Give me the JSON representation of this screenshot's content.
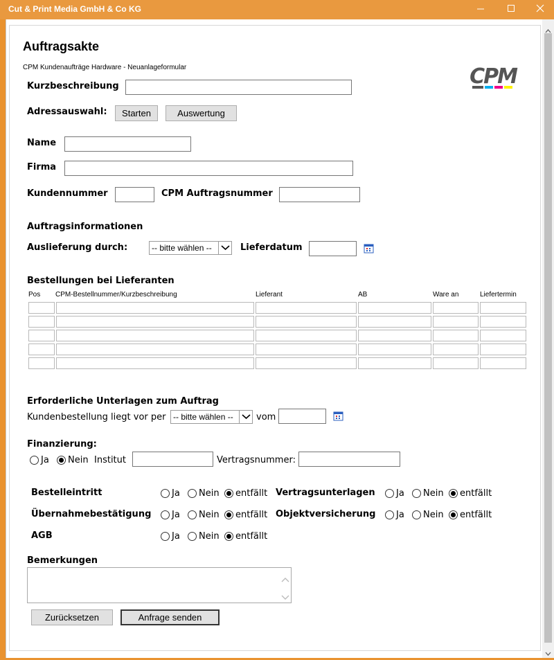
{
  "window": {
    "title": "Cut & Print Media GmbH & Co KG"
  },
  "logo": {
    "text": "CPM"
  },
  "page": {
    "heading": "Auftragsakte",
    "subheading": "CPM Kundenaufträge Hardware - Neuanlageformular"
  },
  "kurzbeschreibung": {
    "label": "Kurzbeschreibung",
    "value": ""
  },
  "adresse": {
    "label": "Adressauswahl:",
    "start_label": "Starten",
    "eval_label": "Auswertung"
  },
  "name": {
    "label": "Name",
    "value": ""
  },
  "firma": {
    "label": "Firma",
    "value": ""
  },
  "kundennummer": {
    "label": "Kundennummer",
    "value": ""
  },
  "auftragsnummer": {
    "label": "CPM Auftragsnummer",
    "value": ""
  },
  "auftragsinfo": {
    "heading": "Auftragsinformationen",
    "auslieferung_label": "Auslieferung durch:",
    "auslieferung_value": "-- bitte wählen --",
    "lieferdatum_label": "Lieferdatum",
    "lieferdatum_value": ""
  },
  "bestellungen": {
    "heading": "Bestellungen bei Lieferanten",
    "columns": [
      "Pos",
      "CPM-Bestellnummer/Kurzbeschreibung",
      "Lieferant",
      "AB",
      "Ware an",
      "Liefertermin"
    ],
    "rows": [
      [
        "",
        "",
        "",
        "",
        "",
        ""
      ],
      [
        "",
        "",
        "",
        "",
        "",
        ""
      ],
      [
        "",
        "",
        "",
        "",
        "",
        ""
      ],
      [
        "",
        "",
        "",
        "",
        "",
        ""
      ],
      [
        "",
        "",
        "",
        "",
        "",
        ""
      ]
    ]
  },
  "unterlagen": {
    "heading": "Erforderliche Unterlagen zum Auftrag",
    "kundenbestellung_label": "Kundenbestellung liegt vor per",
    "kundenbestellung_value": "-- bitte wählen --",
    "vom_label": "vom",
    "vom_value": ""
  },
  "finanzierung": {
    "heading": "Finanzierung:",
    "ja_label": "Ja",
    "nein_label": "Nein",
    "selected": "Nein",
    "institut_label": "Institut",
    "institut_value": "",
    "vertragsnummer_label": "Vertragsnummer:",
    "vertragsnummer_value": ""
  },
  "checks": {
    "options": [
      "Ja",
      "Nein",
      "entfällt"
    ],
    "bestelleintritt": {
      "label": "Bestelleintritt",
      "selected": "entfällt"
    },
    "vertragsunterlagen": {
      "label": "Vertragsunterlagen",
      "selected": "entfällt"
    },
    "uebernahme": {
      "label": "Übernahmebestätigung",
      "selected": "entfällt"
    },
    "objektversicherung": {
      "label": "Objektversicherung",
      "selected": "entfällt"
    },
    "agb": {
      "label": "AGB",
      "selected": "entfällt"
    }
  },
  "bemerkungen": {
    "label": "Bemerkungen",
    "value": ""
  },
  "actions": {
    "reset_label": "Zurücksetzen",
    "submit_label": "Anfrage senden"
  },
  "colors": {
    "titlebar": "#e9993f",
    "logo_gray": "#555555",
    "logo_cyan": "#00aeef",
    "logo_magenta": "#ec008c",
    "logo_yellow": "#fff200"
  }
}
